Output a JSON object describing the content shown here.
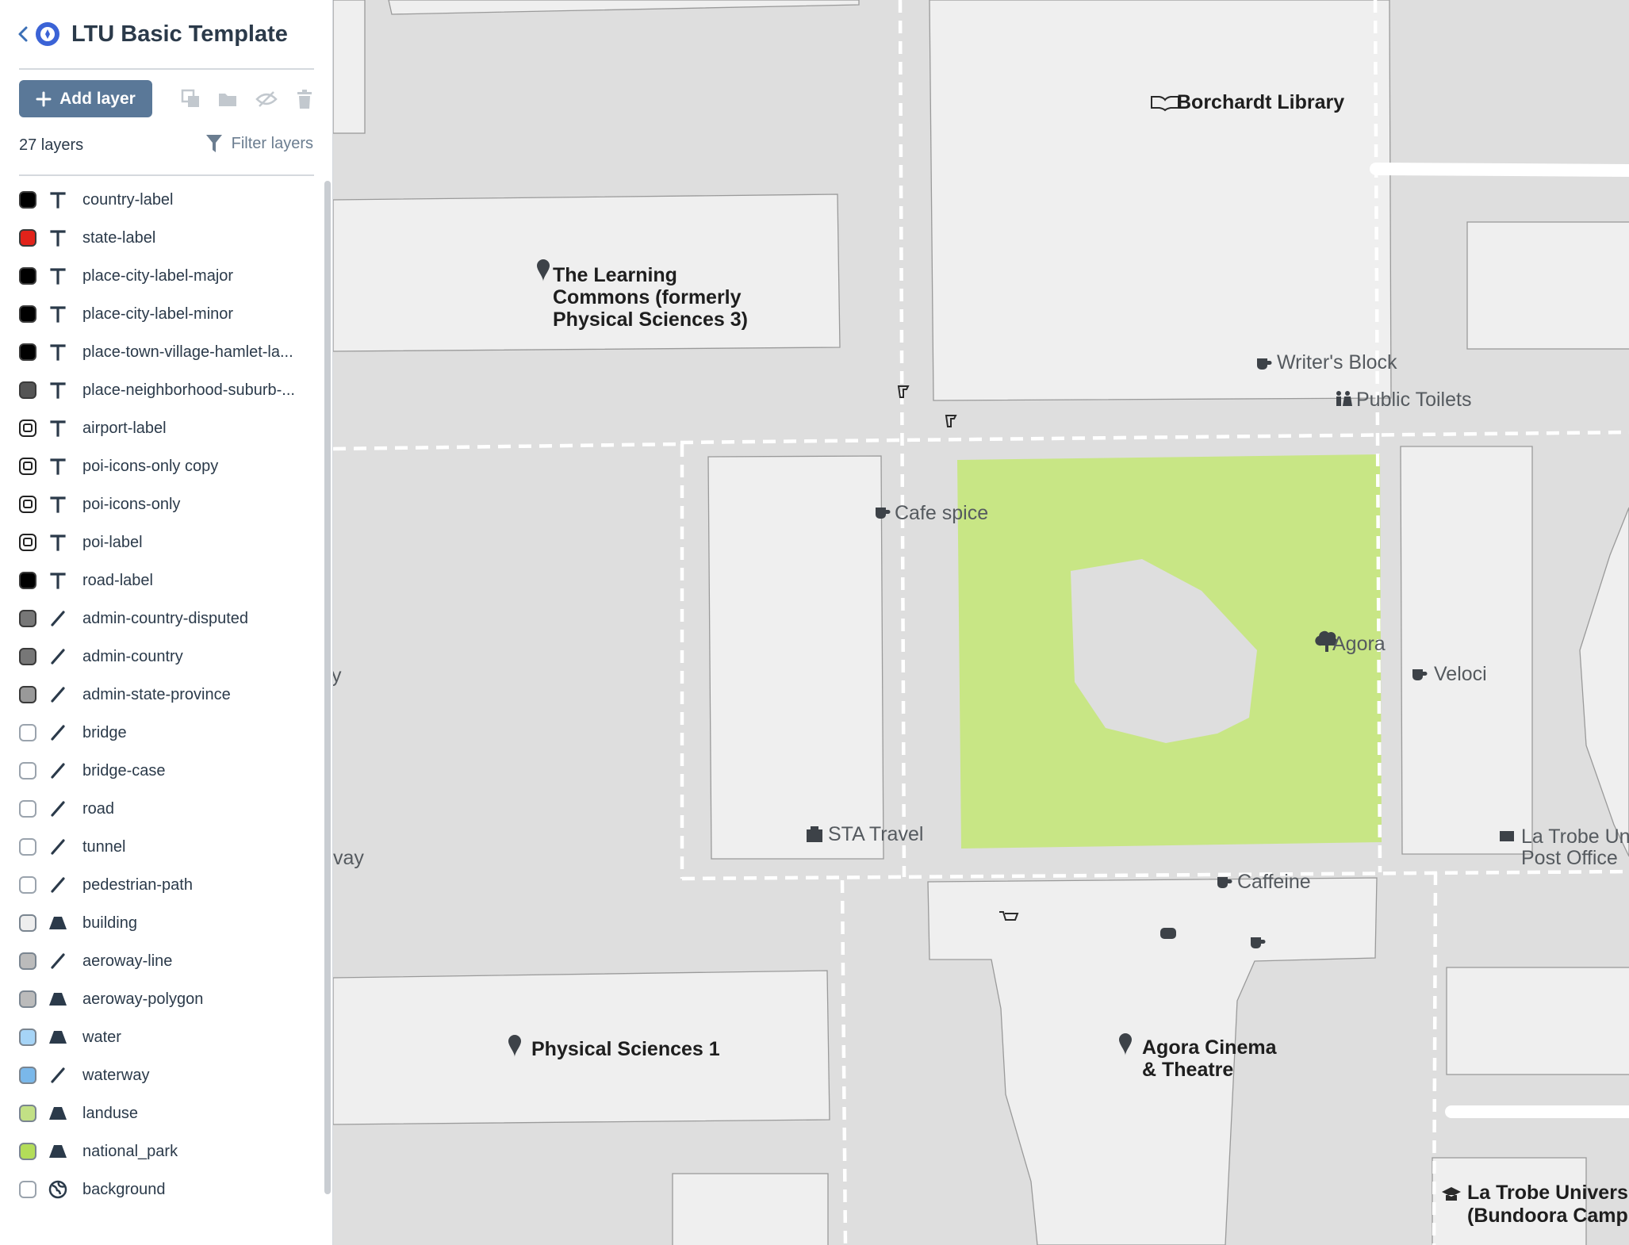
{
  "header": {
    "title": "LTU Basic Template"
  },
  "toolbar": {
    "add_layer_label": "Add layer"
  },
  "layers_count": "27 layers",
  "filter": {
    "label": "Filter layers"
  },
  "colors": {
    "accent": "#5a7898",
    "park": "#c8e685",
    "building": "#efefef",
    "ground": "#dedede"
  },
  "layers": [
    {
      "name": "country-label",
      "type": "symbol",
      "color": "#000000"
    },
    {
      "name": "state-label",
      "type": "symbol",
      "color": "#e2231a"
    },
    {
      "name": "place-city-label-major",
      "type": "symbol",
      "color": "#000000"
    },
    {
      "name": "place-city-label-minor",
      "type": "symbol",
      "color": "#000000"
    },
    {
      "name": "place-town-village-hamlet-la...",
      "type": "symbol",
      "color": "#000000"
    },
    {
      "name": "place-neighborhood-suburb-...",
      "type": "symbol",
      "color": "#555555"
    },
    {
      "name": "airport-label",
      "type": "symbol",
      "color": "icon"
    },
    {
      "name": "poi-icons-only copy",
      "type": "symbol",
      "color": "icon"
    },
    {
      "name": "poi-icons-only",
      "type": "symbol",
      "color": "icon"
    },
    {
      "name": "poi-label",
      "type": "symbol",
      "color": "icon"
    },
    {
      "name": "road-label",
      "type": "symbol",
      "color": "#000000"
    },
    {
      "name": "admin-country-disputed",
      "type": "line",
      "color": "#777777"
    },
    {
      "name": "admin-country",
      "type": "line",
      "color": "#777777"
    },
    {
      "name": "admin-state-province",
      "type": "line",
      "color": "#999999"
    },
    {
      "name": "bridge",
      "type": "line",
      "color": "#ffffff"
    },
    {
      "name": "bridge-case",
      "type": "line",
      "color": "#ffffff"
    },
    {
      "name": "road",
      "type": "line",
      "color": "#ffffff"
    },
    {
      "name": "tunnel",
      "type": "line",
      "color": "#ffffff"
    },
    {
      "name": "pedestrian-path",
      "type": "line",
      "color": "#ffffff"
    },
    {
      "name": "building",
      "type": "fill",
      "color": "#eeeeee"
    },
    {
      "name": "aeroway-line",
      "type": "line",
      "color": "#bbbbbb"
    },
    {
      "name": "aeroway-polygon",
      "type": "fill",
      "color": "#bbbbbb"
    },
    {
      "name": "water",
      "type": "fill",
      "color": "#a6d4f6"
    },
    {
      "name": "waterway",
      "type": "line",
      "color": "#7ab8ea"
    },
    {
      "name": "landuse",
      "type": "fill",
      "color": "#c2e085"
    },
    {
      "name": "national_park",
      "type": "fill",
      "color": "#b3dd59"
    },
    {
      "name": "background",
      "type": "background",
      "color": "#ffffff"
    }
  ],
  "map": {
    "labels": {
      "borchardt": "Borchardt Library",
      "learning1": "The Learning",
      "learning2": "Commons (formerly",
      "learning3": "Physical Sciences 3)",
      "writers": "Writer's Block",
      "toilets": "Public Toilets",
      "cafe_spice": "Cafe spice",
      "agora": "Agora",
      "veloci": "Veloci",
      "sta": "STA Travel",
      "caffeine": "Caffeine",
      "post1": "La Trobe Univ",
      "post2": "Post Office",
      "phys1": "Physical Sciences 1",
      "cinema1": "Agora Cinema",
      "cinema2": "& Theatre",
      "ltu1": "La Trobe University",
      "ltu2": "(Bundoora Campus)",
      "way1": "y",
      "way2": "vay"
    }
  }
}
